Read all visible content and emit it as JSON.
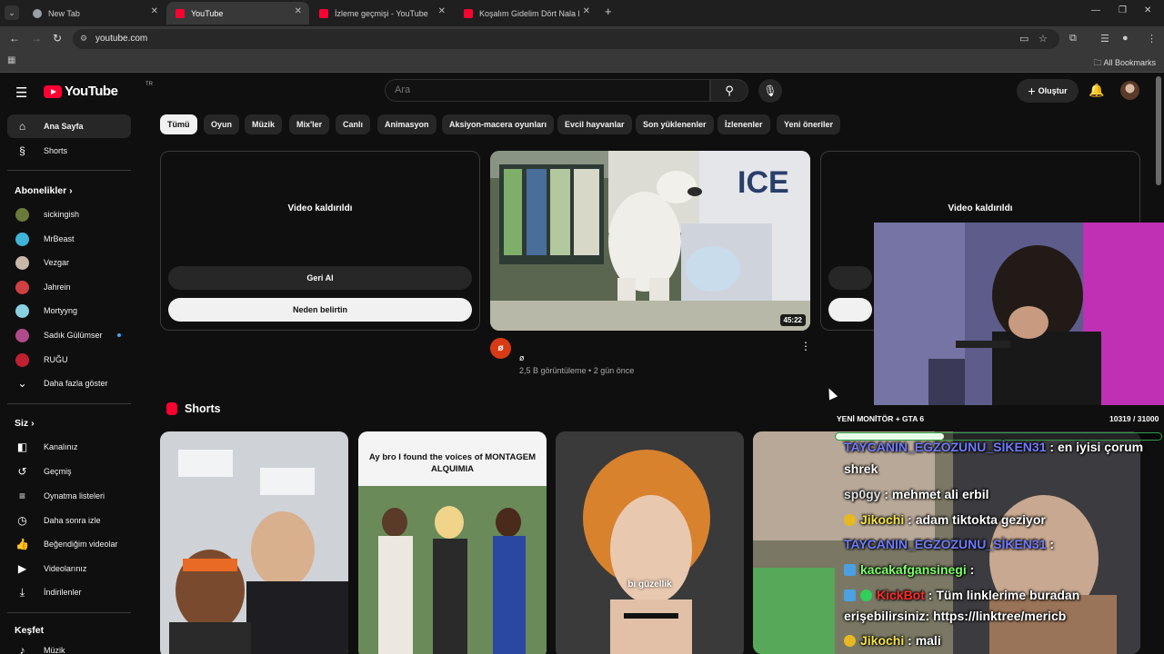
{
  "browser": {
    "tabs": [
      {
        "title": "New Tab",
        "favicon": "chrome-icon",
        "active": false
      },
      {
        "title": "YouTube",
        "favicon": "youtube-icon",
        "active": true
      },
      {
        "title": "İzleme geçmişi - YouTube",
        "favicon": "youtube-icon",
        "active": false
      },
      {
        "title": "Koşalım Gidelim Dört Nala Hey…",
        "favicon": "youtube-icon",
        "active": false
      }
    ],
    "url": "youtube.com",
    "bookmarks_label": "All Bookmarks"
  },
  "masthead": {
    "logo_text": "YouTube",
    "country_code": "TR",
    "search_placeholder": "Ara",
    "create_label": "Oluştur"
  },
  "sidebar": {
    "main": [
      {
        "label": "Ana Sayfa",
        "icon": "home-icon",
        "active": true
      },
      {
        "label": "Shorts",
        "icon": "shorts-icon",
        "active": false
      }
    ],
    "subscriptions_heading": "Abonelikler",
    "subscriptions": [
      {
        "label": "sickingish",
        "color": "#6b7a3a",
        "new": false
      },
      {
        "label": "MrBeast",
        "color": "#3fb4d8",
        "new": false
      },
      {
        "label": "Vezgar",
        "color": "#c8b8a8",
        "new": false
      },
      {
        "label": "Jahrein",
        "color": "#d04040",
        "new": false
      },
      {
        "label": "Mortyyng",
        "color": "#8ad0e0",
        "new": false
      },
      {
        "label": "Sadık Gülümser",
        "color": "#b04a8a",
        "new": true
      },
      {
        "label": "RUĞU",
        "color": "#c02030",
        "new": false
      }
    ],
    "show_more": "Daha fazla göster",
    "you_heading": "Siz",
    "you_items": [
      {
        "label": "Kanalınız",
        "icon": "channel-icon"
      },
      {
        "label": "Geçmiş",
        "icon": "history-icon"
      },
      {
        "label": "Oynatma listeleri",
        "icon": "playlist-icon"
      },
      {
        "label": "Daha sonra izle",
        "icon": "clock-icon"
      },
      {
        "label": "Beğendiğim videolar",
        "icon": "like-icon"
      },
      {
        "label": "Videolarınız",
        "icon": "video-icon"
      },
      {
        "label": "İndirilenler",
        "icon": "download-icon"
      }
    ],
    "explore_heading": "Keşfet",
    "explore_items": [
      {
        "label": "Müzik",
        "icon": "music-icon"
      }
    ]
  },
  "chips": [
    "Tümü",
    "Oyun",
    "Müzik",
    "Mix'ler",
    "Canlı",
    "Animasyon",
    "Aksiyon-macera oyunları",
    "Evcil hayvanlar",
    "Son yüklenenler",
    "İzlenenler",
    "Yeni öneriler"
  ],
  "videos": {
    "removed_title": "Video kaldırıldı",
    "undo_label": "Geri Al",
    "why_label": "Neden belirtin",
    "featured": {
      "duration": "45:22",
      "channel_avatar": "ø",
      "title": "ø",
      "meta": "2,5 B görüntüleme • 2 gün önce"
    }
  },
  "shorts": {
    "heading": "Shorts",
    "items": [
      {
        "caption": ""
      },
      {
        "caption": "Ay bro I found the voices of MONTAGEM ALQUIMIA"
      },
      {
        "caption": "bi güzellik"
      },
      {
        "caption": ""
      }
    ]
  },
  "stream_overlay": {
    "goal_label": "YENİ MONİTÖR + GTA 6",
    "goal_count": "10319 / 31000",
    "goal_progress": 0.333,
    "chat": [
      {
        "user": "TAYCANIN_EGZOZUNU_SİKEN31",
        "message": ": en iyisi çorum",
        "color": "#6f7bff"
      },
      {
        "user": "",
        "message": "shrek",
        "color": "#ffffff"
      },
      {
        "user": "sp0gy",
        "message": ": mehmet ali erbil",
        "color": "#e0e0e0"
      },
      {
        "user": "Jikochi",
        "message": ": adam tiktokta geziyor",
        "color": "#f5e642"
      },
      {
        "user": "TAYCANIN_EGZOZUNU_SİKEN31",
        "message": ":",
        "color": "#6f7bff"
      },
      {
        "user": "kacakafgansinegi",
        "message": ":",
        "color": "#7dff6a"
      },
      {
        "user": "KickBot",
        "message": ": Tüm linklerime buradan",
        "color": "#ff2a2a"
      },
      {
        "user": "",
        "message": "erişebilirsiniz: https://linktree/mericb",
        "color": "#ffffff"
      },
      {
        "user": "Jikochi",
        "message": ": mali",
        "color": "#f5e642"
      }
    ]
  }
}
